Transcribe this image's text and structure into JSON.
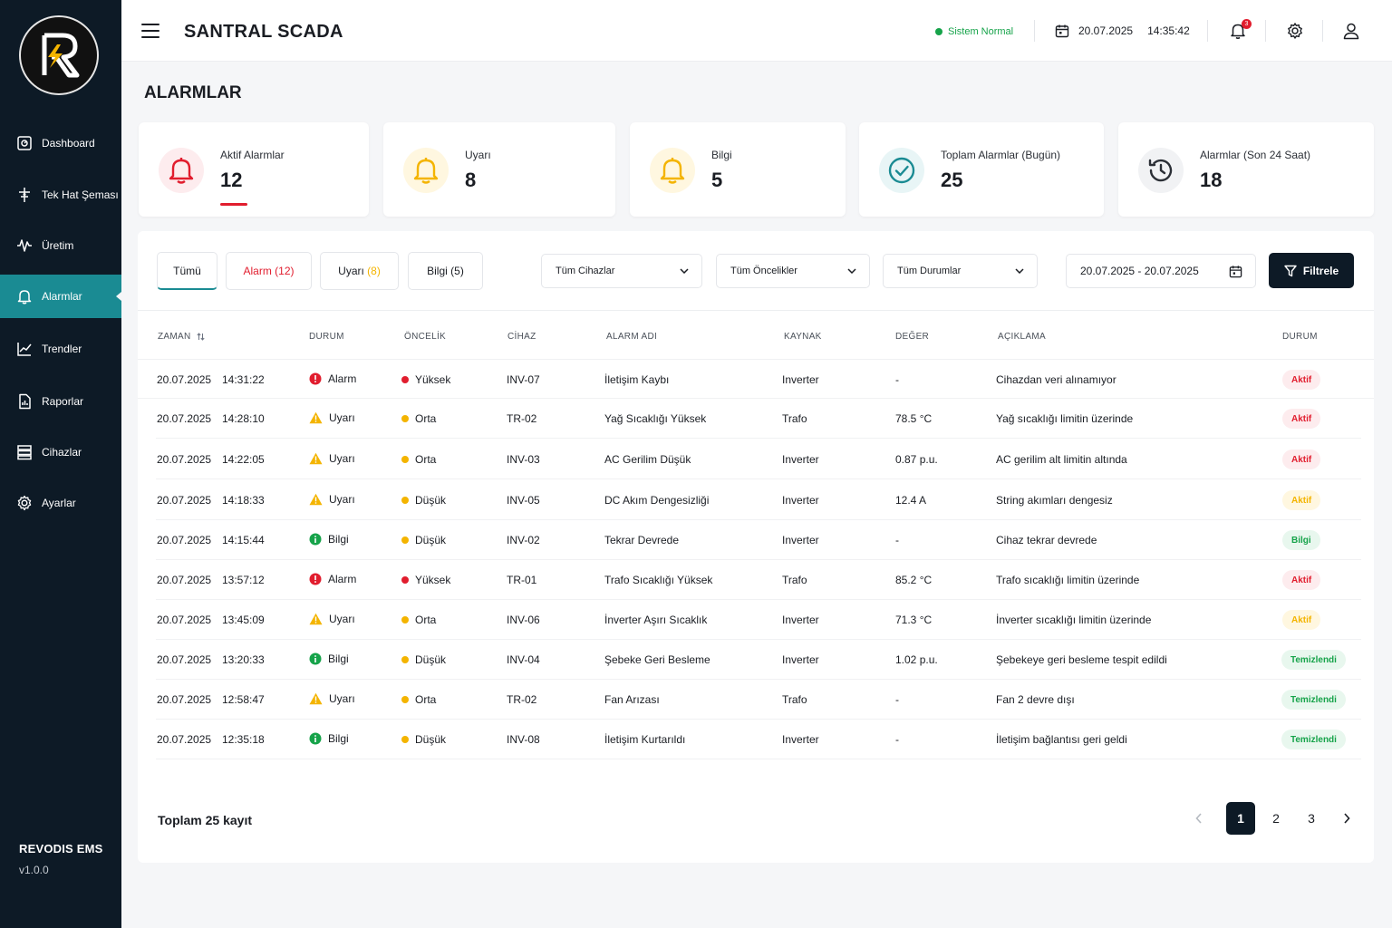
{
  "sidebar": {
    "items": [
      {
        "label": "Dashboard",
        "icon": "dashboard-icon"
      },
      {
        "label": "Tek Hat Şeması",
        "icon": "single-line-diagram-icon"
      },
      {
        "label": "Üretim",
        "icon": "production-icon"
      },
      {
        "label": "Alarmlar",
        "icon": "bell-icon",
        "active": true
      },
      {
        "label": "Trendler",
        "icon": "trend-chart-icon"
      },
      {
        "label": "Raporlar",
        "icon": "report-icon"
      },
      {
        "label": "Cihazlar",
        "icon": "devices-icon"
      },
      {
        "label": "Ayarlar",
        "icon": "gear-icon"
      }
    ],
    "brand": "REVODIS EMS",
    "version": "v1.0.0"
  },
  "header": {
    "title": "SANTRAL SCADA",
    "status": "Sistem Normal",
    "date": "20.07.2025",
    "time": "14:35:42",
    "notification_count": "3"
  },
  "page": {
    "title": "ALARMLAR"
  },
  "stats": [
    {
      "label": "Aktif Alarmlar",
      "value": "12",
      "color": "#e11d2e",
      "icon": "bell-icon"
    },
    {
      "label": "Uyarı",
      "value": "8",
      "color": "#f4b400",
      "icon": "bell-icon"
    },
    {
      "label": "Bilgi",
      "value": "5",
      "color": "#f4b400",
      "icon": "bell-icon"
    },
    {
      "label": "Toplam Alarmlar (Bugün)",
      "value": "25",
      "color": "#1a8b93",
      "icon": "check-circle-icon"
    },
    {
      "label": "Alarmlar (Son 24 Saat)",
      "value": "18",
      "color": "#2b2f36",
      "icon": "history-icon"
    }
  ],
  "tabs": [
    {
      "label": "Tümü"
    },
    {
      "label": "Alarm",
      "count": "(12)"
    },
    {
      "label": "Uyarı",
      "count": "(8)"
    },
    {
      "label": "Bilgi",
      "count": "(5)"
    }
  ],
  "filters": {
    "devices": "Tüm Cihazlar",
    "priorities": "Tüm Öncelikler",
    "statuses": "Tüm Durumlar",
    "date_range": "20.07.2025 - 20.07.2025",
    "button": "Filtrele"
  },
  "table": {
    "headers": [
      "ZAMAN",
      "DURUM",
      "ÖNCELİK",
      "CİHAZ",
      "ALARM ADI",
      "KAYNAK",
      "DEĞER",
      "AÇIKLAMA",
      "DURUM"
    ],
    "rows": [
      {
        "date": "20.07.2025",
        "time": "14:31:22",
        "type": "Alarm",
        "priority": "Yüksek",
        "device": "INV-07",
        "name": "İletişim Kaybı",
        "source": "Inverter",
        "value": "-",
        "desc": "Cihazdan veri alınamıyor",
        "status": "Aktif"
      },
      {
        "date": "20.07.2025",
        "time": "14:28:10",
        "type": "Uyarı",
        "priority": "Orta",
        "device": "TR-02",
        "name": "Yağ Sıcaklığı Yüksek",
        "source": "Trafo",
        "value": "78.5 °C",
        "desc": "Yağ sıcaklığı limitin üzerinde",
        "status": "Aktif"
      },
      {
        "date": "20.07.2025",
        "time": "14:22:05",
        "type": "Uyarı",
        "priority": "Orta",
        "device": "INV-03",
        "name": "AC Gerilim Düşük",
        "source": "Inverter",
        "value": "0.87 p.u.",
        "desc": "AC gerilim alt limitin altında",
        "status": "Aktif"
      },
      {
        "date": "20.07.2025",
        "time": "14:18:33",
        "type": "Uyarı",
        "priority": "Düşük",
        "device": "INV-05",
        "name": "DC Akım Dengesizliği",
        "source": "Inverter",
        "value": "12.4 A",
        "desc": "String akımları dengesiz",
        "status": "Aktif"
      },
      {
        "date": "20.07.2025",
        "time": "14:15:44",
        "type": "Bilgi",
        "priority": "Düşük",
        "device": "INV-02",
        "name": "Tekrar Devrede",
        "source": "Inverter",
        "value": "-",
        "desc": "Cihaz tekrar devrede",
        "status": "Bilgi"
      },
      {
        "date": "20.07.2025",
        "time": "13:57:12",
        "type": "Alarm",
        "priority": "Yüksek",
        "device": "TR-01",
        "name": "Trafo Sıcaklığı Yüksek",
        "source": "Trafo",
        "value": "85.2 °C",
        "desc": "Trafo sıcaklığı limitin üzerinde",
        "status": "Aktif"
      },
      {
        "date": "20.07.2025",
        "time": "13:45:09",
        "type": "Uyarı",
        "priority": "Orta",
        "device": "INV-06",
        "name": "İnverter Aşırı Sıcaklık",
        "source": "Inverter",
        "value": "71.3 °C",
        "desc": "İnverter sıcaklığı limitin üzerinde",
        "status": "Aktif"
      },
      {
        "date": "20.07.2025",
        "time": "13:20:33",
        "type": "Bilgi",
        "priority": "Düşük",
        "device": "INV-04",
        "name": "Şebeke Geri Besleme",
        "source": "Inverter",
        "value": "1.02 p.u.",
        "desc": "Şebekeye geri besleme tespit edildi",
        "status": "Temizlendi"
      },
      {
        "date": "20.07.2025",
        "time": "12:58:47",
        "type": "Uyarı",
        "priority": "Orta",
        "device": "TR-02",
        "name": "Fan Arızası",
        "source": "Trafo",
        "value": "-",
        "desc": "Fan 2 devre dışı",
        "status": "Temizlendi"
      },
      {
        "date": "20.07.2025",
        "time": "12:35:18",
        "type": "Bilgi",
        "priority": "Düşük",
        "device": "INV-08",
        "name": "İletişim Kurtarıldı",
        "source": "Inverter",
        "value": "-",
        "desc": "İletişim bağlantısı geri geldi",
        "status": "Temizlendi"
      }
    ]
  },
  "footer": {
    "total": "Toplam 25 kayıt",
    "pages": [
      "1",
      "2",
      "3"
    ],
    "current_page": "1"
  },
  "colors": {
    "sidebar_bg": "#0d1a26",
    "accent": "#1a8b93",
    "alarm": "#e11d2e",
    "warning": "#f4b400",
    "info": "#16a34a"
  }
}
